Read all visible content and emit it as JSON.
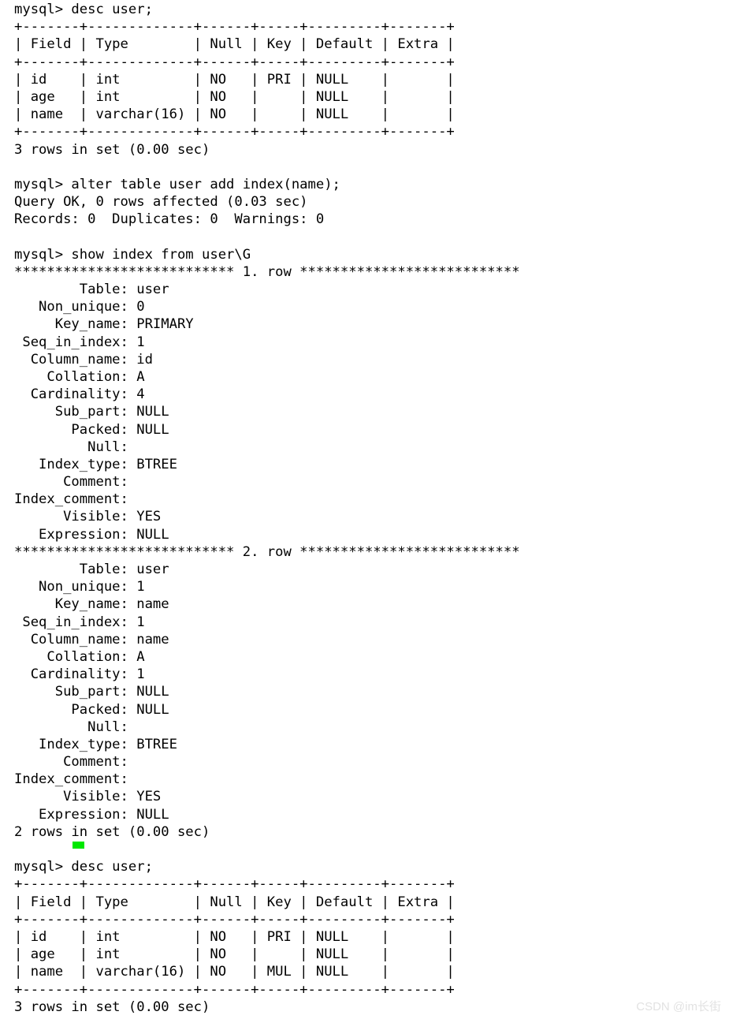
{
  "terminal": {
    "prompt": "mysql> ",
    "cursor_color": "#00e800",
    "background_color": "#ffffff",
    "text_color": "#000000",
    "lines": [
      "mysql> desc user;",
      "+-------+-------------+------+-----+---------+-------+",
      "| Field | Type        | Null | Key | Default | Extra |",
      "+-------+-------------+------+-----+---------+-------+",
      "| id    | int         | NO   | PRI | NULL    |       |",
      "| age   | int         | NO   |     | NULL    |       |",
      "| name  | varchar(16) | NO   |     | NULL    |       |",
      "+-------+-------------+------+-----+---------+-------+",
      "3 rows in set (0.00 sec)",
      "",
      "mysql> alter table user add index(name);",
      "Query OK, 0 rows affected (0.03 sec)",
      "Records: 0  Duplicates: 0  Warnings: 0",
      "",
      "mysql> show index from user\\G",
      "*************************** 1. row ***************************",
      "        Table: user",
      "   Non_unique: 0",
      "     Key_name: PRIMARY",
      " Seq_in_index: 1",
      "  Column_name: id",
      "    Collation: A",
      "  Cardinality: 4",
      "     Sub_part: NULL",
      "       Packed: NULL",
      "         Null: ",
      "   Index_type: BTREE",
      "      Comment: ",
      "Index_comment: ",
      "      Visible: YES",
      "   Expression: NULL",
      "*************************** 2. row ***************************",
      "        Table: user",
      "   Non_unique: 1",
      "     Key_name: name",
      " Seq_in_index: 1",
      "  Column_name: name",
      "    Collation: A",
      "  Cardinality: 1",
      "     Sub_part: NULL",
      "       Packed: NULL",
      "         Null: ",
      "   Index_type: BTREE",
      "      Comment: ",
      "Index_comment: ",
      "      Visible: YES",
      "   Expression: NULL",
      "2 rows in set (0.00 sec)",
      "",
      "mysql> desc user;",
      "+-------+-------------+------+-----+---------+-------+",
      "| Field | Type        | Null | Key | Default | Extra |",
      "+-------+-------------+------+-----+---------+-------+",
      "| id    | int         | NO   | PRI | NULL    |       |",
      "| age   | int         | NO   |     | NULL    |       |",
      "| name  | varchar(16) | NO   | MUL | NULL    |       |",
      "+-------+-------------+------+-----+---------+-------+",
      "3 rows in set (0.00 sec)"
    ],
    "commands": [
      "desc user;",
      "alter table user add index(name);",
      "show index from user\\G",
      "desc user;"
    ],
    "desc_table_before": {
      "headers": [
        "Field",
        "Type",
        "Null",
        "Key",
        "Default",
        "Extra"
      ],
      "rows": [
        [
          "id",
          "int",
          "NO",
          "PRI",
          "NULL",
          ""
        ],
        [
          "age",
          "int",
          "NO",
          "",
          "NULL",
          ""
        ],
        [
          "name",
          "varchar(16)",
          "NO",
          "",
          "NULL",
          ""
        ]
      ],
      "footer": "3 rows in set (0.00 sec)"
    },
    "alter_result": {
      "status": "Query OK, 0 rows affected (0.03 sec)",
      "records": "Records: 0  Duplicates: 0  Warnings: 0"
    },
    "show_index_rows": [
      {
        "row_header": "*************************** 1. row ***************************",
        "Table": "user",
        "Non_unique": "0",
        "Key_name": "PRIMARY",
        "Seq_in_index": "1",
        "Column_name": "id",
        "Collation": "A",
        "Cardinality": "4",
        "Sub_part": "NULL",
        "Packed": "NULL",
        "Null": "",
        "Index_type": "BTREE",
        "Comment": "",
        "Index_comment": "",
        "Visible": "YES",
        "Expression": "NULL"
      },
      {
        "row_header": "*************************** 2. row ***************************",
        "Table": "user",
        "Non_unique": "1",
        "Key_name": "name",
        "Seq_in_index": "1",
        "Column_name": "name",
        "Collation": "A",
        "Cardinality": "1",
        "Sub_part": "NULL",
        "Packed": "NULL",
        "Null": "",
        "Index_type": "BTREE",
        "Comment": "",
        "Index_comment": "",
        "Visible": "YES",
        "Expression": "NULL"
      }
    ],
    "show_index_footer": "2 rows in set (0.00 sec)",
    "desc_table_after": {
      "headers": [
        "Field",
        "Type",
        "Null",
        "Key",
        "Default",
        "Extra"
      ],
      "rows": [
        [
          "id",
          "int",
          "NO",
          "PRI",
          "NULL",
          ""
        ],
        [
          "age",
          "int",
          "NO",
          "",
          "NULL",
          ""
        ],
        [
          "name",
          "varchar(16)",
          "NO",
          "MUL",
          "NULL",
          ""
        ]
      ],
      "footer": "3 rows in set (0.00 sec)"
    }
  },
  "watermark": {
    "text": "CSDN @im长街"
  }
}
